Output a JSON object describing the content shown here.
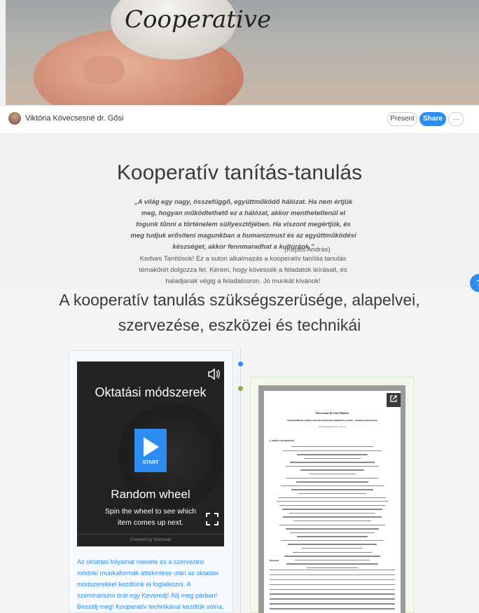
{
  "hero": {
    "stone_text": "Cooperative"
  },
  "author": {
    "name": "Viktória Kövecsesné dr. Gősi"
  },
  "actions": {
    "present": "Present",
    "share": "Share",
    "more": "..."
  },
  "header": {
    "title": "Kooperatív tanítás-tanulás",
    "quote": "„A világ egy nagy, összefüggő, együttműködő hálózat. Ha nem értjük meg, hogyan működtethető ez a hálózat, akkor menthetetlenül el fogunk tűnni a történelem süllyesztőjében. Ha viszont megértjük, és meg tudjuk erősíteni magunkban a humanizmust és az együttműködési készséget, akkor fennmaradhat a kultúránk.”",
    "quote_author": "(Kepes András)",
    "intro": "Kedves Tanítósok! Ez a sutori alkalmazás a kooperatív tanítás tanulás témakörét dolgozza fel. Kérem, hogy kövessék a feladatok leírásait, és haladjanak végig a feladatsoron. Jó munkát kívánok!"
  },
  "help": {
    "label": "?"
  },
  "section": {
    "title": "A kooperatív tanulás szükségszerüsége, alapelvei, szervezése, eszközei és technikái"
  },
  "wheel": {
    "title": "Oktatási módszerek",
    "start": "START",
    "name": "Random wheel",
    "description": "Spin the wheel to see which item comes up next.",
    "powered": "Powered by Wordwall"
  },
  "card_text": "Az oktatási folyamat menete és a szervezési módok/ munkaformák áttekintése után az oktatási módszerekkel kezdtünk el foglalkozni. A szemináriumi órát egy Keveredj! Állj meg párban! Beszélj meg! Kooperatív technikával kezdtük volna, mely során a témáinkkal",
  "document": {
    "author": "Kövecsesné dr. Gősi Viktória",
    "title": "Együttműködve tipikus oktatási módszerek jelenléttel a tanítás - tanulási folyamatban",
    "meta": "In: Iskolakultúra, 2015. XXV. 4.",
    "section1": "I. MIÉRT KOOPERATÍV",
    "section2": "Bevezetés"
  },
  "icons": {
    "speaker": "speaker-icon",
    "expand": "expand-icon",
    "open": "open-external-icon",
    "play": "play-icon"
  },
  "colors": {
    "accent": "#2d8cf0",
    "green": "#7cb342"
  }
}
